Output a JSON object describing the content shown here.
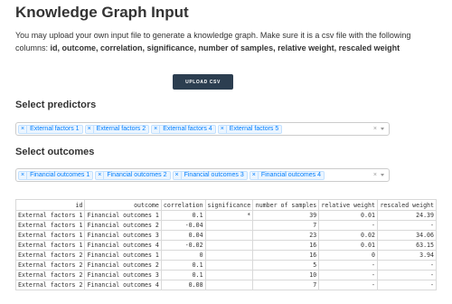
{
  "page": {
    "title": "Knowledge Graph Input",
    "description_prefix": "You may upload your own input file to generate a knowledge graph. Make sure it is a csv file with the following columns: ",
    "description_columns": "id, outcome, correlation, significance, number of samples, relative weight, rescaled weight",
    "upload_label": "UPLOAD CSV"
  },
  "predictors": {
    "heading": "Select predictors",
    "selected": [
      "External factors 1",
      "External factors 2",
      "External factors 4",
      "External factors 5"
    ],
    "clear_symbol": "×"
  },
  "outcomes": {
    "heading": "Select outcomes",
    "selected": [
      "Financial outcomes 1",
      "Financial outcomes 2",
      "Financial outcomes 3",
      "Financial outcomes 4"
    ],
    "clear_symbol": "×"
  },
  "table": {
    "columns": [
      "id",
      "outcome",
      "correlation",
      "significance",
      "number of samples",
      "relative weight",
      "rescaled weight"
    ],
    "rows": [
      [
        "External factors 1",
        "Financial outcomes 1",
        "0.1",
        "*",
        "39",
        "0.01",
        "24.39"
      ],
      [
        "External factors 1",
        "Financial outcomes 2",
        "-0.04",
        "",
        "7",
        "-",
        "-"
      ],
      [
        "External factors 1",
        "Financial outcomes 3",
        "0.04",
        "",
        "23",
        "0.02",
        "34.06"
      ],
      [
        "External factors 1",
        "Financial outcomes 4",
        "-0.02",
        "",
        "16",
        "0.01",
        "63.15"
      ],
      [
        "External factors 2",
        "Financial outcomes 1",
        "0",
        "",
        "16",
        "0",
        "3.94"
      ],
      [
        "External factors 2",
        "Financial outcomes 2",
        "0.1",
        "",
        "5",
        "-",
        "-"
      ],
      [
        "External factors 2",
        "Financial outcomes 3",
        "0.1",
        "",
        "10",
        "-",
        "-"
      ],
      [
        "External factors 2",
        "Financial outcomes 4",
        "0.08",
        "",
        "7",
        "-",
        "-"
      ]
    ]
  }
}
